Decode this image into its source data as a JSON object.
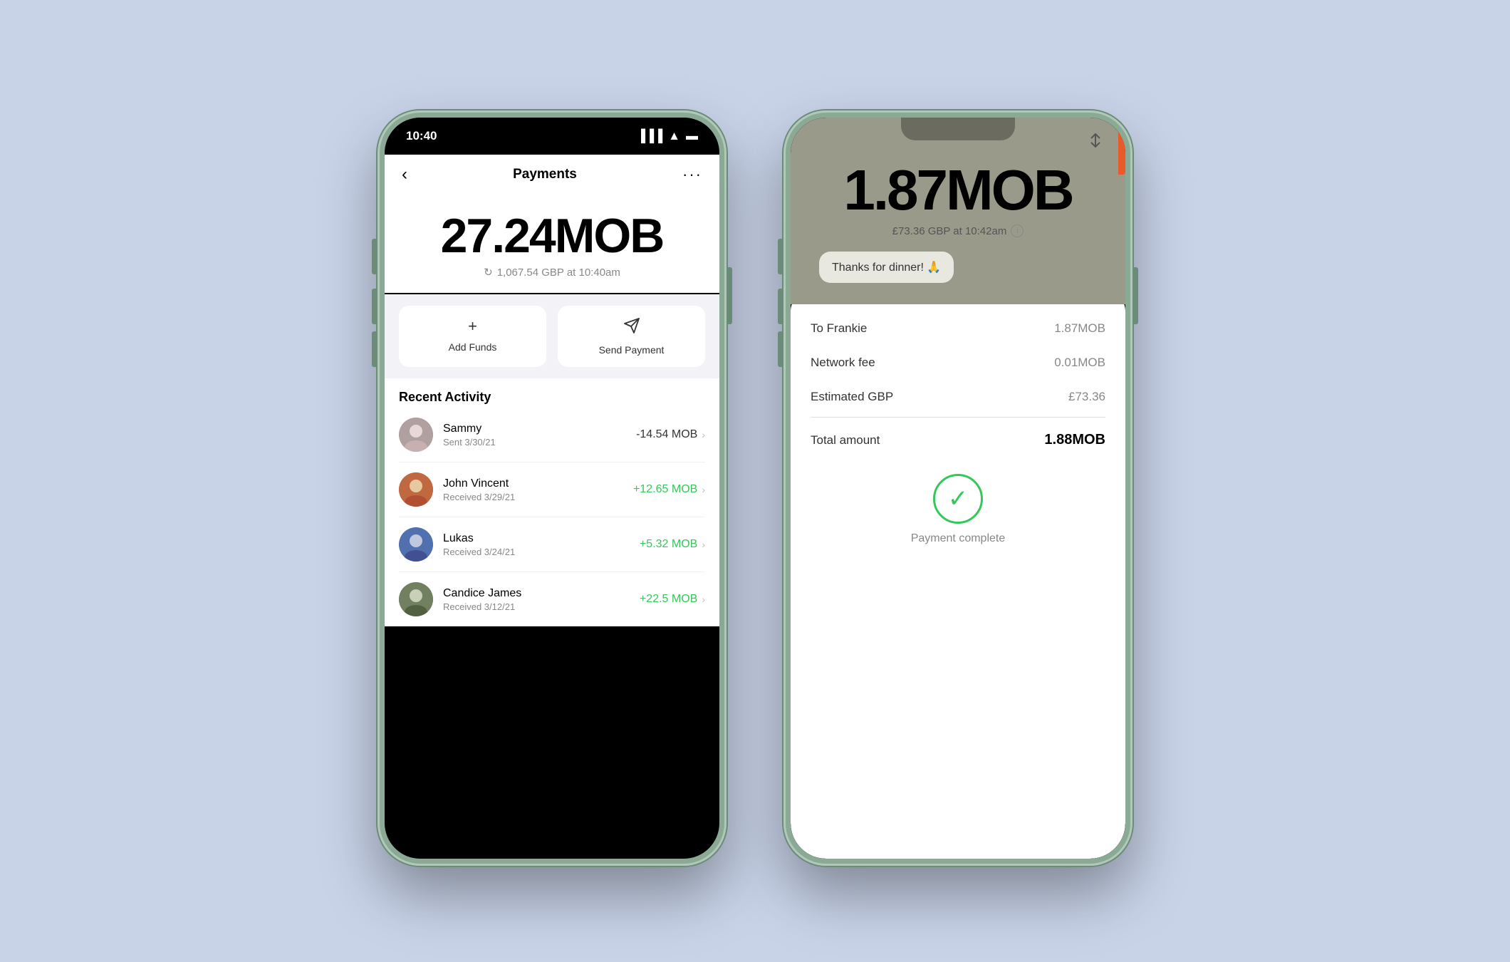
{
  "background_color": "#c8d3e8",
  "phone1": {
    "status_time": "10:40",
    "nav": {
      "title": "Payments",
      "back_label": "‹",
      "dots_label": "···"
    },
    "balance": {
      "amount": "27.24",
      "currency": "MOB",
      "gbp_value": "1,067.54 GBP at 10:40am"
    },
    "actions": [
      {
        "id": "add-funds",
        "icon": "+",
        "label": "Add Funds"
      },
      {
        "id": "send-payment",
        "icon": "send",
        "label": "Send Payment"
      }
    ],
    "recent_activity": {
      "title": "Recent Activity",
      "items": [
        {
          "name": "Sammy",
          "date": "Sent 3/30/21",
          "amount": "-14.54 MOB",
          "type": "negative",
          "emoji": "👤"
        },
        {
          "name": "John Vincent",
          "date": "Received 3/29/21",
          "amount": "+12.65 MOB",
          "type": "positive",
          "emoji": "👤"
        },
        {
          "name": "Lukas",
          "date": "Received 3/24/21",
          "amount": "+5.32 MOB",
          "type": "positive",
          "emoji": "👤"
        },
        {
          "name": "Candice James",
          "date": "Received 3/12/21",
          "amount": "+22.5 MOB",
          "type": "positive",
          "emoji": "👤"
        }
      ]
    }
  },
  "phone2": {
    "status_time": "",
    "balance": {
      "amount": "1.87",
      "currency": "MOB",
      "gbp_value": "£73.36 GBP at 10:42am"
    },
    "message": "Thanks for dinner! 🙏",
    "payment_details": {
      "to_label": "To Frankie",
      "to_value": "1.87MOB",
      "fee_label": "Network fee",
      "fee_value": "0.01MOB",
      "gbp_label": "Estimated GBP",
      "gbp_value": "£73.36",
      "total_label": "Total amount",
      "total_value": "1.88MOB"
    },
    "complete": {
      "label": "Payment complete"
    }
  }
}
